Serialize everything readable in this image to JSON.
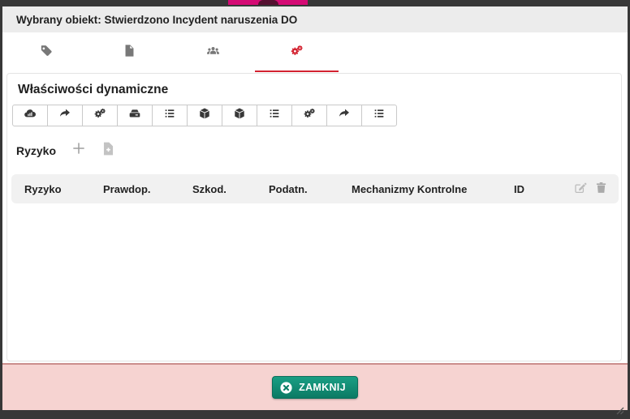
{
  "window": {
    "title": "Wybrany obiekt: Stwierdzono Incydent naruszenia DO"
  },
  "tabs": [
    {
      "icon": "tag-icon",
      "active": false
    },
    {
      "icon": "file-icon",
      "active": false
    },
    {
      "icon": "users-icon",
      "active": false
    },
    {
      "icon": "gears-icon",
      "active": true
    }
  ],
  "panel": {
    "title": "Właściwości dynamiczne"
  },
  "toolbar": {
    "buttons": [
      "cloud-icon",
      "share-icon",
      "gears-icon",
      "hdd-icon",
      "list-icon",
      "cube-icon",
      "cube-icon",
      "list-icon",
      "gears-icon",
      "share-icon",
      "list-icon"
    ]
  },
  "risk_section": {
    "label": "Ryzyko",
    "icons": [
      "plus-icon",
      "file-plus-icon"
    ]
  },
  "table": {
    "headers": [
      "Ryzyko",
      "Prawdop.",
      "Szkod.",
      "Podatn.",
      "Mechanizmy Kontrolne",
      "ID"
    ],
    "header_action_icons": [
      "edit-icon",
      "trash-icon"
    ],
    "rows": []
  },
  "footer": {
    "close_label": "ZAMKNIJ"
  },
  "colors": {
    "accent_red": "#d32230",
    "magenta_strip": "#d40a74",
    "button_teal": "#128067",
    "footer_pink": "#f6d3d1",
    "titlebar_gray": "#ececec",
    "frame_dark": "#373737"
  }
}
